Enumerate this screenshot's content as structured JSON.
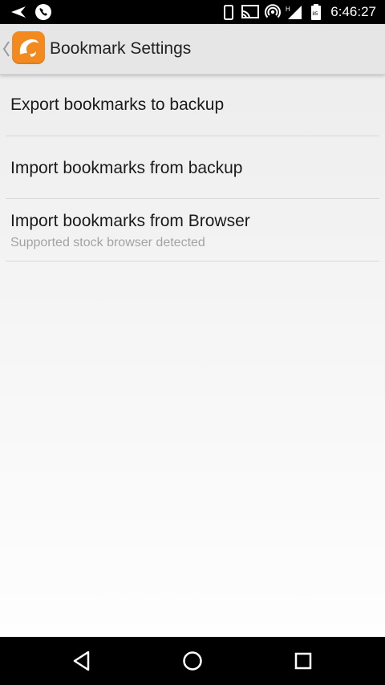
{
  "status_bar": {
    "time": "6:46:27",
    "icons": [
      "send-icon",
      "phone-call-icon",
      "phone-device-icon",
      "cast-icon",
      "hotspot-icon",
      "signal-h-icon",
      "battery-icon"
    ]
  },
  "action_bar": {
    "title": "Bookmark Settings",
    "logo_color": "#f28a1f"
  },
  "settings": {
    "items": [
      {
        "title": "Export bookmarks to backup"
      },
      {
        "title": "Import bookmarks from backup"
      },
      {
        "title": "Import bookmarks from Browser",
        "summary": "Supported stock browser detected"
      }
    ]
  },
  "nav_bar": {
    "icons": [
      "back-icon",
      "home-icon",
      "recents-icon"
    ]
  }
}
